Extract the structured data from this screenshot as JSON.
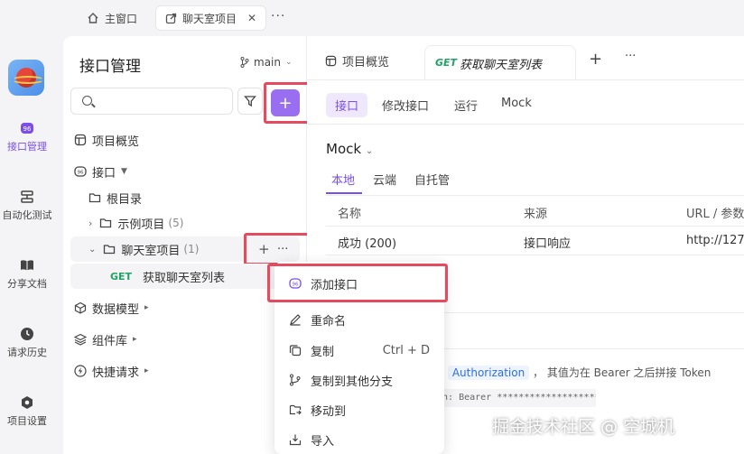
{
  "window_tabs": [
    {
      "label": "主窗口",
      "icon": "home-icon"
    },
    {
      "label": "聊天室项目",
      "icon": "external-link-icon"
    }
  ],
  "window_more": "···",
  "rail": [
    {
      "label": "接口管理",
      "icon": "api-icon",
      "active": true
    },
    {
      "label": "自动化测试",
      "icon": "stack-icon"
    },
    {
      "label": "分享文档",
      "icon": "book-icon"
    },
    {
      "label": "请求历史",
      "icon": "clock-icon"
    },
    {
      "label": "项目设置",
      "icon": "hexagon-icon"
    }
  ],
  "sidebar": {
    "title": "接口管理",
    "branch": "main",
    "search_placeholder": "",
    "add_label": "+",
    "tree": {
      "overview": "项目概览",
      "api": "接口",
      "root": "根目录",
      "sample": "示例项目",
      "sample_count": "(5)",
      "chatroom": "聊天室项目",
      "chatroom_count": "(1)",
      "endpoint_method": "GET",
      "endpoint_name": "获取聊天室列表",
      "models": "数据模型",
      "components": "组件库",
      "quick": "快捷请求"
    },
    "row_actions": {
      "add": "+",
      "more": "···"
    }
  },
  "main": {
    "tabs": [
      {
        "label": "项目概览"
      },
      {
        "method": "GET",
        "label": "获取聊天室列表"
      }
    ],
    "tab_add": "+",
    "tab_more": "···",
    "subnav": [
      "接口",
      "修改接口",
      "运行",
      "Mock"
    ],
    "mock_title": "Mock",
    "mock_tabs": [
      "本地",
      "云端",
      "自托管"
    ],
    "table": {
      "headers": [
        "名称",
        "来源",
        "URL / 参数"
      ],
      "rows": [
        [
          "成功 (200)",
          "接口响应",
          "http://127."
        ]
      ]
    },
    "desc_prefix": "效",
    "desc_auth": "Authorization",
    "desc_suffix": "， 其值为在 Bearer 之后拼接 Token",
    "code_text": "on: Bearer ********************"
  },
  "context_menu": {
    "items": [
      {
        "label": "添加接口",
        "icon": "api-icon"
      },
      {
        "label": "重命名",
        "icon": "pencil-icon"
      },
      {
        "label": "复制",
        "icon": "copy-icon",
        "shortcut": "Ctrl + D"
      },
      {
        "label": "复制到其他分支",
        "icon": "branch-icon"
      },
      {
        "label": "移动到",
        "icon": "folder-move-icon"
      },
      {
        "label": "导入",
        "icon": "import-icon"
      }
    ]
  },
  "watermark": "掘金技术社区 @ 空城机",
  "colors": {
    "accent": "#7b4ee8",
    "highlight": "#e64a5f",
    "get": "#21a366"
  }
}
